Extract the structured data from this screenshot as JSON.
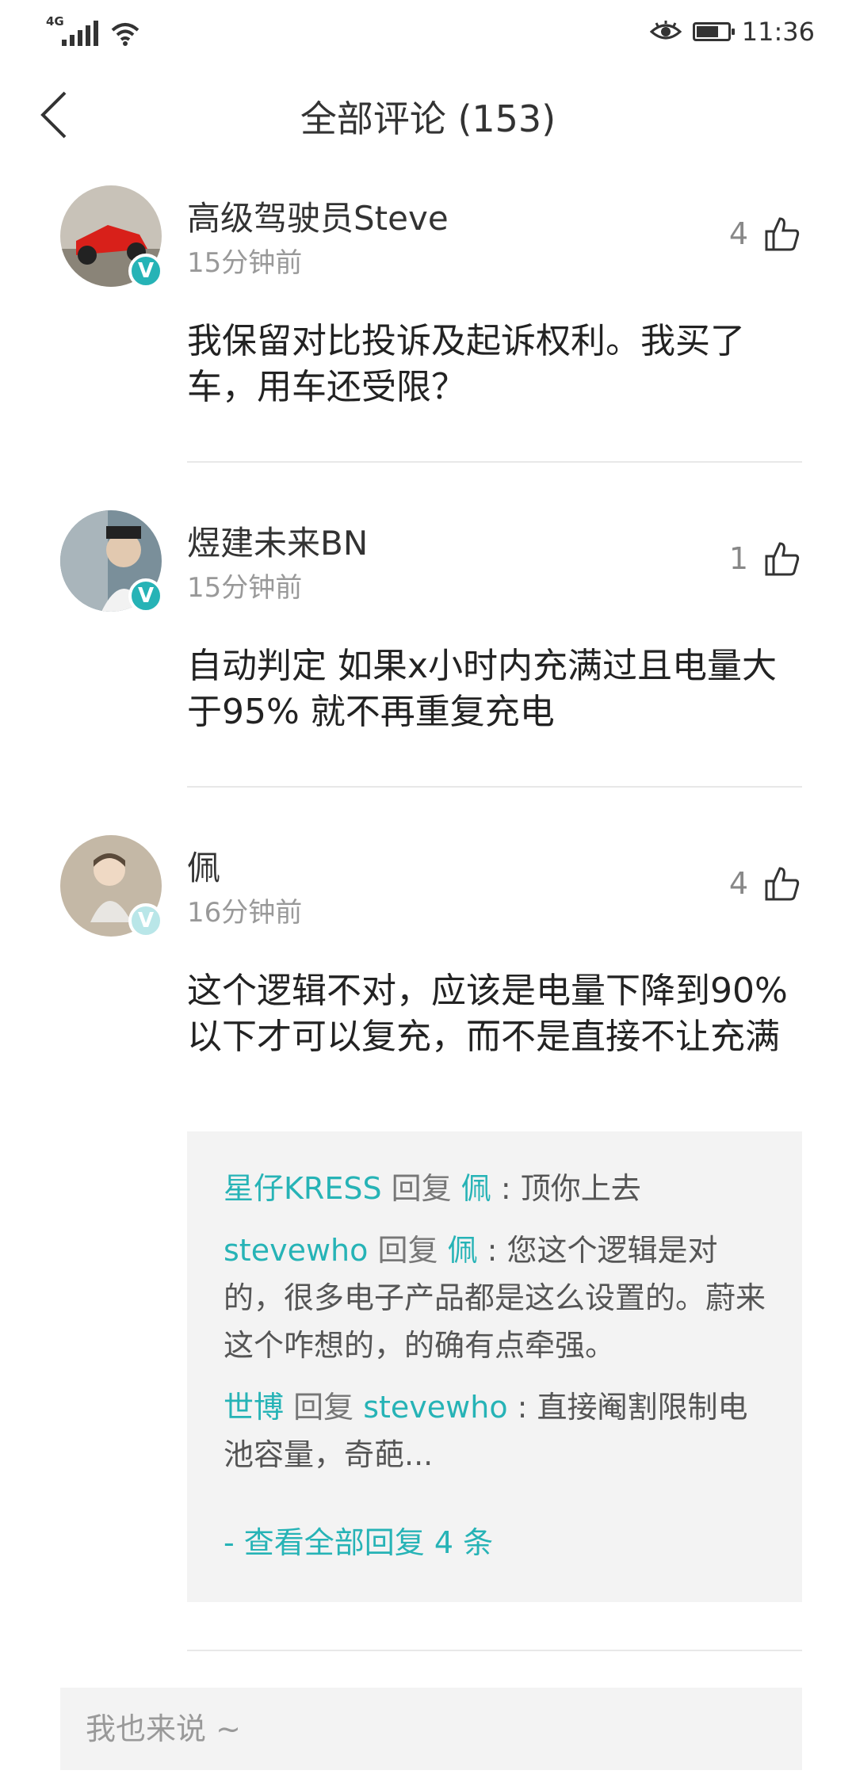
{
  "status_bar": {
    "network": "4G",
    "time": "11:36",
    "battery_level": 0.7
  },
  "header": {
    "title": "全部评论 (153)"
  },
  "comments": [
    {
      "author": "高级驾驶员Steve",
      "time": "15分钟前",
      "likes": "4",
      "text": "我保留对比投诉及起诉权利。我买了车，用车还受限？",
      "avatar_colors": [
        "#c8c2b8",
        "#d8201a"
      ],
      "badge_color": "#26b3b6"
    },
    {
      "author": "煜建未来BN",
      "time": "15分钟前",
      "likes": "1",
      "text": "自动判定 如果x小时内充满过且电量大于95% 就不再重复充电",
      "avatar_colors": [
        "#7a8f9a",
        "#e2c9b0"
      ],
      "badge_color": "#26b3b6"
    },
    {
      "author": "佩",
      "time": "16分钟前",
      "likes": "4",
      "text": "这个逻辑不对，应该是电量下降到90%以下才可以复充，而不是直接不让充满",
      "avatar_colors": [
        "#c4b8a6",
        "#efd9c4"
      ],
      "badge_color": "#b9e6e8"
    }
  ],
  "replies": [
    {
      "from": "星仔KRESS",
      "verb": "回复",
      "to": "佩",
      "text": ": 顶你上去"
    },
    {
      "from": "stevewho",
      "verb": "回复",
      "to": "佩",
      "text": ": 您这个逻辑是对的，很多电子产品都是这么设置的。蔚来这个咋想的，的确有点牵强。"
    },
    {
      "from": "世博",
      "verb": "回复",
      "to": "stevewho",
      "text": ": 直接阉割限制电池容量，奇葩..."
    }
  ],
  "view_all_replies": "- 查看全部回复 4 条",
  "input": {
    "placeholder": "我也来说 ~"
  },
  "colors": {
    "accent": "#26b3b6",
    "divider": "#e8e8e8",
    "reply_bg": "#f3f3f3"
  },
  "icons": {
    "back": "chevron-left-icon",
    "like": "thumbs-up-icon",
    "verified": "verified-badge-icon"
  }
}
